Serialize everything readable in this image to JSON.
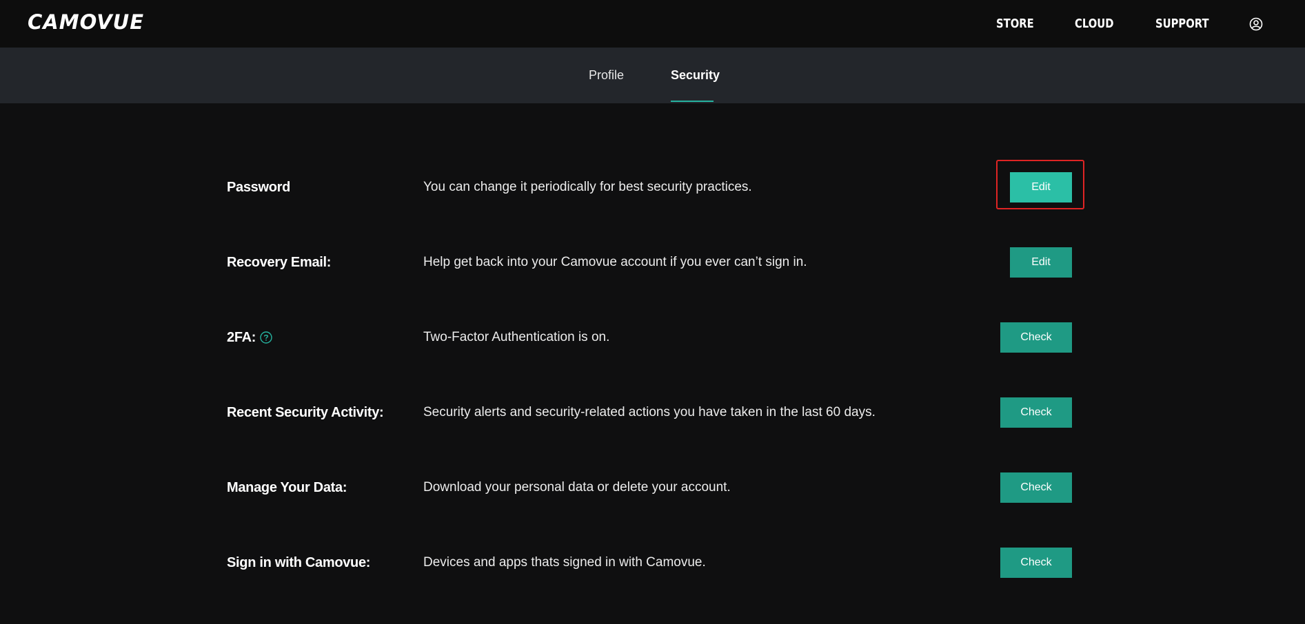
{
  "header": {
    "logo_text": "CAMOVUE",
    "nav": [
      "STORE",
      "CLOUD",
      "SUPPORT"
    ],
    "user_icon": "user-circle-icon"
  },
  "tabs": {
    "profile": "Profile",
    "security": "Security",
    "active": "Security"
  },
  "rows": [
    {
      "label": "Password",
      "description": "You can change it periodically for best security practices.",
      "button": "Edit"
    },
    {
      "label": "Recovery Email:",
      "description": "Help get back into your Camovue account if you ever can’t sign in.",
      "button": "Edit"
    },
    {
      "label": "2FA:",
      "description": "Two-Factor Authentication is on.",
      "button": "Check",
      "icon": "help-circle-icon"
    },
    {
      "label": "Recent Security Activity:",
      "description": "Security alerts and security-related actions you have taken in the last 60 days.",
      "button": "Check"
    },
    {
      "label": "Manage Your Data:",
      "description": "Download your personal data or delete your account.",
      "button": "Check"
    },
    {
      "label": "Sign in with Camovue:",
      "description": "Devices and apps thats signed in with Camovue.",
      "button": "Check"
    }
  ],
  "colors": {
    "background": "#0f0f10",
    "subnav": "#23262b",
    "accent": "#26b3a0",
    "button": "#1f9a84",
    "highlight": "#e02424"
  }
}
